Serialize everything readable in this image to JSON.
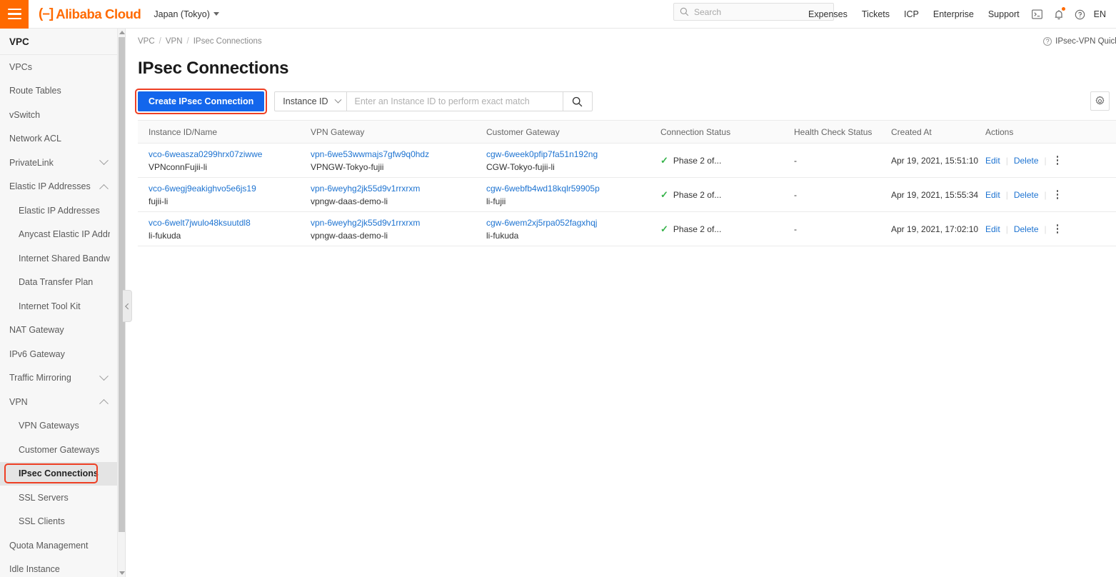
{
  "topnav": {
    "menu_icon": "hamburger-menu-icon",
    "brand": "Alibaba Cloud",
    "brand_mark": "(-]",
    "region": "Japan (Tokyo)",
    "search_placeholder": "Search",
    "links": [
      "Expenses",
      "Tickets",
      "ICP",
      "Enterprise",
      "Support"
    ],
    "icons": [
      "console-terminal-icon",
      "notification-bell-icon",
      "help-circle-icon"
    ],
    "language": "EN"
  },
  "sidebar": {
    "title": "VPC",
    "items": [
      {
        "label": "VPCs",
        "sub": false,
        "expandable": false,
        "active": false
      },
      {
        "label": "Route Tables",
        "sub": false,
        "expandable": false,
        "active": false
      },
      {
        "label": "vSwitch",
        "sub": false,
        "expandable": false,
        "active": false
      },
      {
        "label": "Network ACL",
        "sub": false,
        "expandable": false,
        "active": false
      },
      {
        "label": "PrivateLink",
        "sub": false,
        "expandable": true,
        "expanded": false,
        "active": false
      },
      {
        "label": "Elastic IP Addresses",
        "sub": false,
        "expandable": true,
        "expanded": true,
        "active": false
      },
      {
        "label": "Elastic IP Addresses",
        "sub": true,
        "expandable": false,
        "active": false
      },
      {
        "label": "Anycast Elastic IP Addresses",
        "sub": true,
        "expandable": false,
        "active": false
      },
      {
        "label": "Internet Shared Bandwidth",
        "sub": true,
        "expandable": false,
        "active": false
      },
      {
        "label": "Data Transfer Plan",
        "sub": true,
        "expandable": false,
        "active": false
      },
      {
        "label": "Internet Tool Kit",
        "sub": true,
        "expandable": false,
        "active": false
      },
      {
        "label": "NAT Gateway",
        "sub": false,
        "expandable": false,
        "active": false
      },
      {
        "label": "IPv6 Gateway",
        "sub": false,
        "expandable": false,
        "active": false
      },
      {
        "label": "Traffic Mirroring",
        "sub": false,
        "expandable": true,
        "expanded": false,
        "active": false
      },
      {
        "label": "VPN",
        "sub": false,
        "expandable": true,
        "expanded": true,
        "active": false
      },
      {
        "label": "VPN Gateways",
        "sub": true,
        "expandable": false,
        "active": false
      },
      {
        "label": "Customer Gateways",
        "sub": true,
        "expandable": false,
        "active": false
      },
      {
        "label": "IPsec Connections",
        "sub": true,
        "expandable": false,
        "active": true
      },
      {
        "label": "SSL Servers",
        "sub": true,
        "expandable": false,
        "active": false
      },
      {
        "label": "SSL Clients",
        "sub": true,
        "expandable": false,
        "active": false
      },
      {
        "label": "Quota Management",
        "sub": false,
        "expandable": false,
        "active": false
      },
      {
        "label": "Idle Instance",
        "sub": false,
        "expandable": false,
        "active": false
      }
    ],
    "collapse_icon": "chevron-left-icon"
  },
  "breadcrumb": {
    "items": [
      "VPC",
      "VPN",
      "IPsec Connections"
    ],
    "separator": "/"
  },
  "quick_link": {
    "label": "IPsec-VPN Quick",
    "icon": "question-circle-icon"
  },
  "page": {
    "title": "IPsec Connections"
  },
  "toolbar": {
    "create_label": "Create IPsec Connection",
    "filter_selected": "Instance ID",
    "search_placeholder": "Enter an Instance ID to perform exact match",
    "search_value": "",
    "search_icon": "search-icon",
    "settings_icon": "gear-icon"
  },
  "table": {
    "columns": [
      "Instance ID/Name",
      "VPN Gateway",
      "Customer Gateway",
      "Connection Status",
      "Health Check Status",
      "Created At",
      "Actions"
    ],
    "rows": [
      {
        "instance_id": "vco-6weasza0299hrx07ziwwe",
        "instance_name": "VPNconnFujii-li",
        "vpn_gateway_id": "vpn-6we53wwmajs7gfw9q0hdz",
        "vpn_gateway_name": "VPNGW-Tokyo-fujii",
        "customer_gateway_id": "cgw-6week0pfip7fa51n192ng",
        "customer_gateway_name": "CGW-Tokyo-fujii-li",
        "connection_status": "Phase 2 of...",
        "health_check_status": "-",
        "created_at": "Apr 19, 2021, 15:51:10",
        "action_edit": "Edit",
        "action_delete": "Delete"
      },
      {
        "instance_id": "vco-6wegj9eakighvo5e6js19",
        "instance_name": "fujii-li",
        "vpn_gateway_id": "vpn-6weyhg2jk55d9v1rrxrxm",
        "vpn_gateway_name": "vpngw-daas-demo-li",
        "customer_gateway_id": "cgw-6webfb4wd18kqlr59905p",
        "customer_gateway_name": "li-fujii",
        "connection_status": "Phase 2 of...",
        "health_check_status": "-",
        "created_at": "Apr 19, 2021, 15:55:34",
        "action_edit": "Edit",
        "action_delete": "Delete"
      },
      {
        "instance_id": "vco-6welt7jwulo48ksuutdl8",
        "instance_name": "li-fukuda",
        "vpn_gateway_id": "vpn-6weyhg2jk55d9v1rrxrxm",
        "vpn_gateway_name": "vpngw-daas-demo-li",
        "customer_gateway_id": "cgw-6wem2xj5rpa052fagxhqj",
        "customer_gateway_name": "li-fukuda",
        "connection_status": "Phase 2 of...",
        "health_check_status": "-",
        "created_at": "Apr 19, 2021, 17:02:10",
        "action_edit": "Edit",
        "action_delete": "Delete"
      }
    ]
  },
  "colors": {
    "brand_orange": "#ff6a00",
    "primary_blue": "#1366ec",
    "link_blue": "#1d73d1",
    "status_green": "#36b34a",
    "highlight_red": "#ee3f24"
  }
}
